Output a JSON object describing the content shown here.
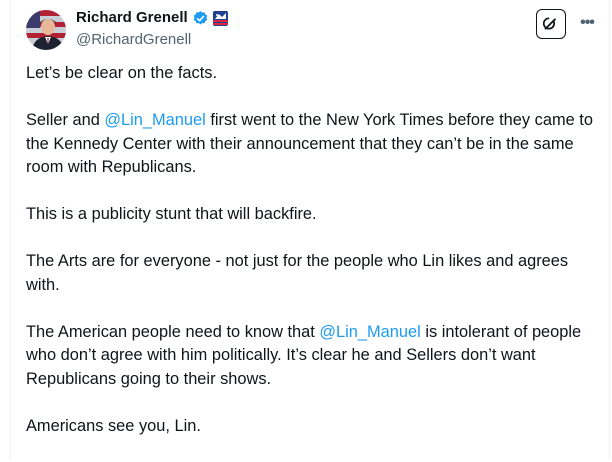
{
  "author": {
    "name": "Richard Grenell",
    "handle": "@RichardGrenell",
    "avatar_icon": "profile-photo",
    "verified_icon": "verified-badge-icon",
    "affiliation_icon": "affiliation-badge-icon"
  },
  "actions": {
    "grok_icon": "grok-icon",
    "more_icon": "more-icon"
  },
  "post": {
    "p1": "Let’s be clear on the facts.",
    "p2_a": "Seller and ",
    "p2_mention": "@Lin_Manuel",
    "p2_b": " first went to the New York Times before they came to the Kennedy Center with their announcement that they can’t be in the same room with Republicans.",
    "p3": "This is a publicity stunt that will backfire.",
    "p4": "The Arts are for everyone - not just for the people who Lin likes and agrees with.",
    "p5_a": "The American people need to know that ",
    "p5_mention": "@Lin_Manuel",
    "p5_b": " is intolerant of people who don’t agree with him politically. It’s clear he and Sellers don’t want Republicans going to their shows.",
    "p6": "Americans see you, Lin."
  },
  "colors": {
    "text": "#0f1419",
    "secondary": "#536471",
    "link": "#1d9bf0",
    "verified": "#1d9bf0"
  }
}
